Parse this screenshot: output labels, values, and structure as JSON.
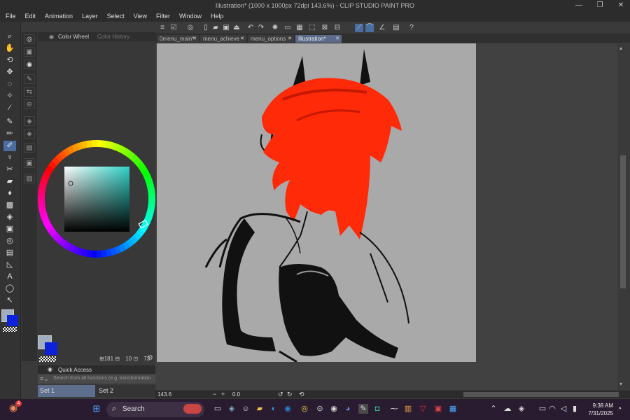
{
  "window": {
    "title": "Illustration* (1000 x 1000px 72dpi 143.6%) - CLIP STUDIO PAINT PRO",
    "controls": {
      "minimize": "—",
      "maximize": "❐",
      "close": "✕"
    }
  },
  "menu": [
    "File",
    "Edit",
    "Animation",
    "Layer",
    "Select",
    "View",
    "Filter",
    "Window",
    "Help"
  ],
  "tabs": [
    {
      "label": "0menu_main*",
      "active": false
    },
    {
      "label": "menu_achieve",
      "active": false
    },
    {
      "label": "menu_options",
      "active": false
    },
    {
      "label": "Illustration*",
      "active": true
    }
  ],
  "tab_close": "✕",
  "color_panel": {
    "tabs": [
      "Color Wheel",
      "Color History"
    ],
    "hue_color": "#2fd1c6",
    "foreground_color": "#a0aebe",
    "background_color": "#0b22d8"
  },
  "layer_info": {
    "a": "181",
    "b": "10",
    "c": "73"
  },
  "quick_access": {
    "title": "Quick Access",
    "search_placeholder": "Search from all functions (e.g. transformation, ol br",
    "sets": [
      "Set 1",
      "Set 2"
    ]
  },
  "canvas_status": {
    "zoom": "143.6",
    "rotation": "0.0"
  },
  "taskbar": {
    "notification_badge": "4",
    "search_label": "Search",
    "time": "9:38 AM",
    "date": "7/31/2025"
  },
  "colors": {
    "accent": "#4a6da0",
    "hair": "#ff2a08",
    "canvas": "#a9a9a9"
  }
}
